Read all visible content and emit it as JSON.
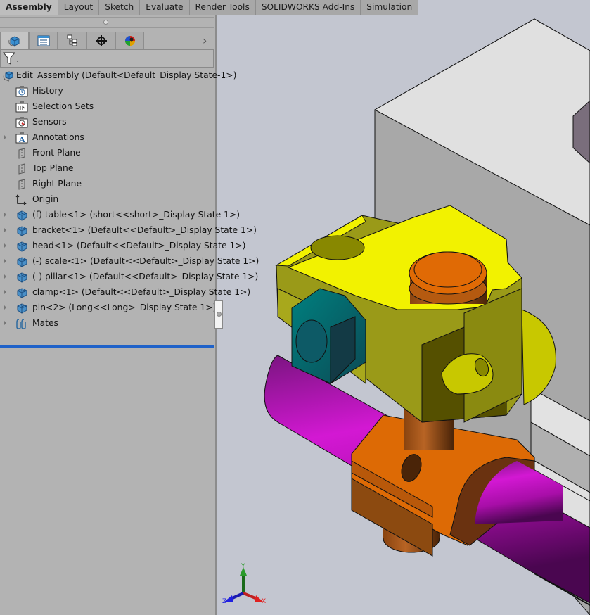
{
  "command_manager": {
    "tabs": [
      {
        "label": "Assembly",
        "active": true
      },
      {
        "label": "Layout"
      },
      {
        "label": "Sketch"
      },
      {
        "label": "Evaluate"
      },
      {
        "label": "Render Tools"
      },
      {
        "label": "SOLIDWORKS Add-Ins"
      },
      {
        "label": "Simulation"
      }
    ]
  },
  "manager_tabs": [
    {
      "icon": "featuremanager-icon",
      "active": true
    },
    {
      "icon": "propertymanager-icon"
    },
    {
      "icon": "configurationmanager-icon"
    },
    {
      "icon": "dimxpertmanager-icon"
    },
    {
      "icon": "displaymanager-icon"
    }
  ],
  "filter": {
    "icon": "filter-icon"
  },
  "tree": {
    "root": {
      "label": "Edit_Assembly  (Default<Default_Display State-1>)",
      "icon": "assembly-icon"
    },
    "items": [
      {
        "label": "History",
        "icon": "history-folder-icon",
        "expandable": false
      },
      {
        "label": "Selection Sets",
        "icon": "selection-sets-folder-icon",
        "expandable": false
      },
      {
        "label": "Sensors",
        "icon": "sensors-folder-icon",
        "expandable": false
      },
      {
        "label": "Annotations",
        "icon": "annotations-folder-icon",
        "expandable": true
      },
      {
        "label": "Front Plane",
        "icon": "plane-icon",
        "expandable": false
      },
      {
        "label": "Top Plane",
        "icon": "plane-icon",
        "expandable": false
      },
      {
        "label": "Right Plane",
        "icon": "plane-icon",
        "expandable": false
      },
      {
        "label": "Origin",
        "icon": "origin-icon",
        "expandable": false
      },
      {
        "label": "(f) table<1> (short<<short>_Display State 1>)",
        "icon": "part-icon",
        "expandable": true
      },
      {
        "label": "bracket<1> (Default<<Default>_Display State 1>)",
        "icon": "part-icon",
        "expandable": true
      },
      {
        "label": "head<1> (Default<<Default>_Display State 1>)",
        "icon": "part-icon",
        "expandable": true
      },
      {
        "label": "(-) scale<1> (Default<<Default>_Display State 1>)",
        "icon": "part-icon",
        "expandable": true
      },
      {
        "label": "(-) pillar<1> (Default<<Default>_Display State 1>)",
        "icon": "part-icon",
        "expandable": true
      },
      {
        "label": "clamp<1> (Default<<Default>_Display State 1>)",
        "icon": "part-icon",
        "expandable": true
      },
      {
        "label": "pin<2> (Long<<Long>_Display State 1>)",
        "icon": "part-icon",
        "expandable": true
      },
      {
        "label": "Mates",
        "icon": "mates-icon",
        "expandable": true
      }
    ]
  },
  "triad": {
    "x_label": "X",
    "y_label": "Y",
    "z_label": "Z"
  },
  "colors": {
    "background": "#c3c6d0",
    "panel": "#b3b3b3",
    "selection_line": "#1f62c9",
    "table": "#e0e0e0",
    "bracket": "#f2f200",
    "knob": "#007a7a",
    "pin": "#e06a05",
    "pipe": "#cc16cc",
    "clamp": "#dd6a05"
  }
}
